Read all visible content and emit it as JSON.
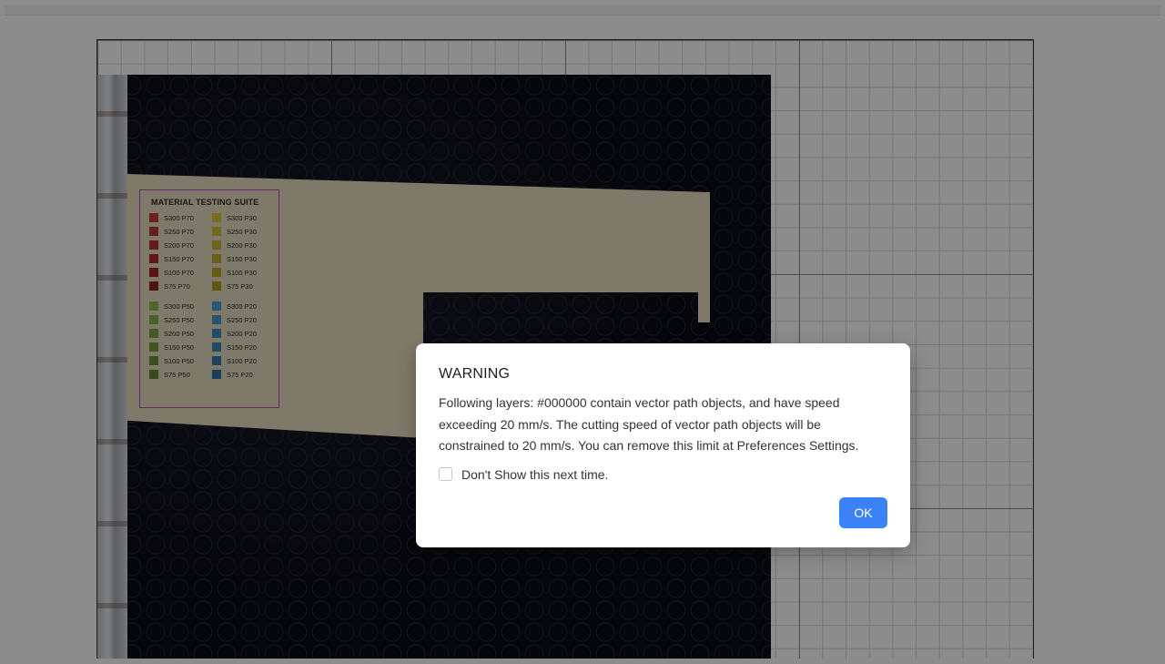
{
  "legend": {
    "title": "MATERIAL TESTING SUITE",
    "group_top": [
      {
        "label": "S300 P70",
        "color": "#c93a3a"
      },
      {
        "label": "S300 P30",
        "color": "#d7c63a"
      },
      {
        "label": "S250 P70",
        "color": "#c23535"
      },
      {
        "label": "S250 P30",
        "color": "#cfc034"
      },
      {
        "label": "S200 P70",
        "color": "#b83030"
      },
      {
        "label": "S200 P30",
        "color": "#c7b82f"
      },
      {
        "label": "S150 P70",
        "color": "#ad2b2b"
      },
      {
        "label": "S150 P30",
        "color": "#beb02a"
      },
      {
        "label": "S100 P70",
        "color": "#a22626"
      },
      {
        "label": "S100 P30",
        "color": "#b5a826"
      },
      {
        "label": "S75 P70",
        "color": "#972121"
      },
      {
        "label": "S75 P30",
        "color": "#aca022"
      }
    ],
    "group_bottom": [
      {
        "label": "S300 P50",
        "color": "#8dbb4e"
      },
      {
        "label": "S300 P20",
        "color": "#4aa3d8"
      },
      {
        "label": "S250 P50",
        "color": "#84b149"
      },
      {
        "label": "S250 P20",
        "color": "#4599ce"
      },
      {
        "label": "S200 P50",
        "color": "#7ba744"
      },
      {
        "label": "S200 P20",
        "color": "#408fc4"
      },
      {
        "label": "S150 P50",
        "color": "#729d3f"
      },
      {
        "label": "S150 P20",
        "color": "#3b85ba"
      },
      {
        "label": "S100 P50",
        "color": "#69933a"
      },
      {
        "label": "S100 P20",
        "color": "#367bb0"
      },
      {
        "label": "S75 P50",
        "color": "#608935"
      },
      {
        "label": "S75 P20",
        "color": "#3171a6"
      }
    ]
  },
  "dialog": {
    "title": "WARNING",
    "message": "Following layers: #000000 contain vector path objects, and have speed exceeding 20 mm/s. The cutting speed of vector path objects will be constrained to 20 mm/s. You can remove this limit at Preferences Settings.",
    "dont_show_label": "Don't Show this next time.",
    "dont_show_checked": false,
    "ok_label": "OK"
  },
  "colors": {
    "primary_button": "#3b82f6",
    "overlay": "rgba(0,0,0,0.45)",
    "legend_border": "#b24ac1"
  }
}
